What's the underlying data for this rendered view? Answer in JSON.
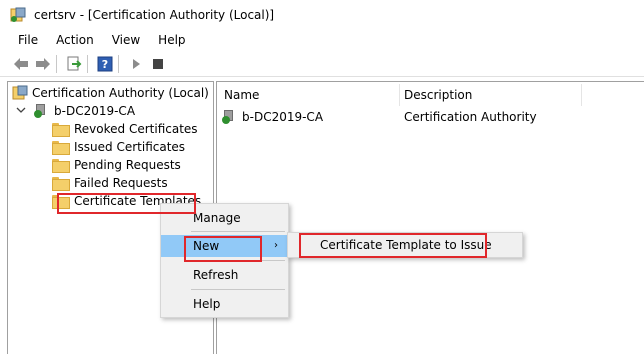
{
  "window": {
    "title": "certsrv - [Certification Authority (Local)]",
    "app_icon": "certsrv-icon"
  },
  "menubar": {
    "items": [
      "File",
      "Action",
      "View",
      "Help"
    ]
  },
  "toolbar": {
    "buttons": [
      "back-arrow-icon",
      "forward-arrow-icon",
      "export-list-icon",
      "help-icon",
      "play-icon",
      "stop-icon"
    ]
  },
  "tree": {
    "root": "Certification Authority (Local)",
    "ca": "b-DC2019-CA",
    "folders": [
      "Revoked Certificates",
      "Issued Certificates",
      "Pending Requests",
      "Failed Requests",
      "Certificate Templates"
    ],
    "selected": "Certificate Templates"
  },
  "list": {
    "columns": [
      "Name",
      "Description"
    ],
    "rows": [
      {
        "name": "b-DC2019-CA",
        "description": "Certification Authority"
      }
    ]
  },
  "context_menu": {
    "items": [
      "Manage",
      "New",
      "Refresh",
      "Help"
    ],
    "highlighted": "New",
    "submenu_arrow": "›"
  },
  "submenu": {
    "items": [
      "Certificate Template to Issue"
    ]
  },
  "colors": {
    "highlight": "#91c9f7",
    "annotation": "#e0272b",
    "folder": "#f4cf6a"
  }
}
